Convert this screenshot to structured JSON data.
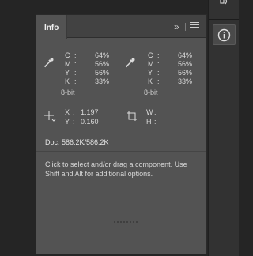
{
  "panel": {
    "tab_label": "Info",
    "collapse_glyph": "»",
    "menu_icon": "hamburger-menu-icon"
  },
  "sample1": {
    "icon": "eyedropper-icon",
    "rows": [
      {
        "label": "C",
        "sep": ":",
        "value": "64%"
      },
      {
        "label": "M",
        "sep": ":",
        "value": "56%"
      },
      {
        "label": "Y",
        "sep": ":",
        "value": "56%"
      },
      {
        "label": "K",
        "sep": ":",
        "value": "33%"
      }
    ],
    "bit": "8-bit"
  },
  "sample2": {
    "icon": "eyedropper-icon",
    "rows": [
      {
        "label": "C",
        "sep": ":",
        "value": "64%"
      },
      {
        "label": "M",
        "sep": ":",
        "value": "56%"
      },
      {
        "label": "Y",
        "sep": ":",
        "value": "56%"
      },
      {
        "label": "K",
        "sep": ":",
        "value": "33%"
      }
    ],
    "bit": "8-bit"
  },
  "position": {
    "icon": "crosshair-icon",
    "x_label": "X",
    "x_sep": ":",
    "x_value": "1.197",
    "y_label": "Y",
    "y_sep": ":",
    "y_value": "0.160"
  },
  "size": {
    "icon": "selection-size-icon",
    "w_label": "W",
    "w_sep": ":",
    "h_label": "H",
    "h_sep": ":"
  },
  "doc": "Doc: 586.2K/586.2K",
  "hint": "Click to select and/or drag a component. Use Shift and Alt for additional options.",
  "dock": {
    "top_icon": "panel-icon",
    "info_icon": "info-icon"
  }
}
